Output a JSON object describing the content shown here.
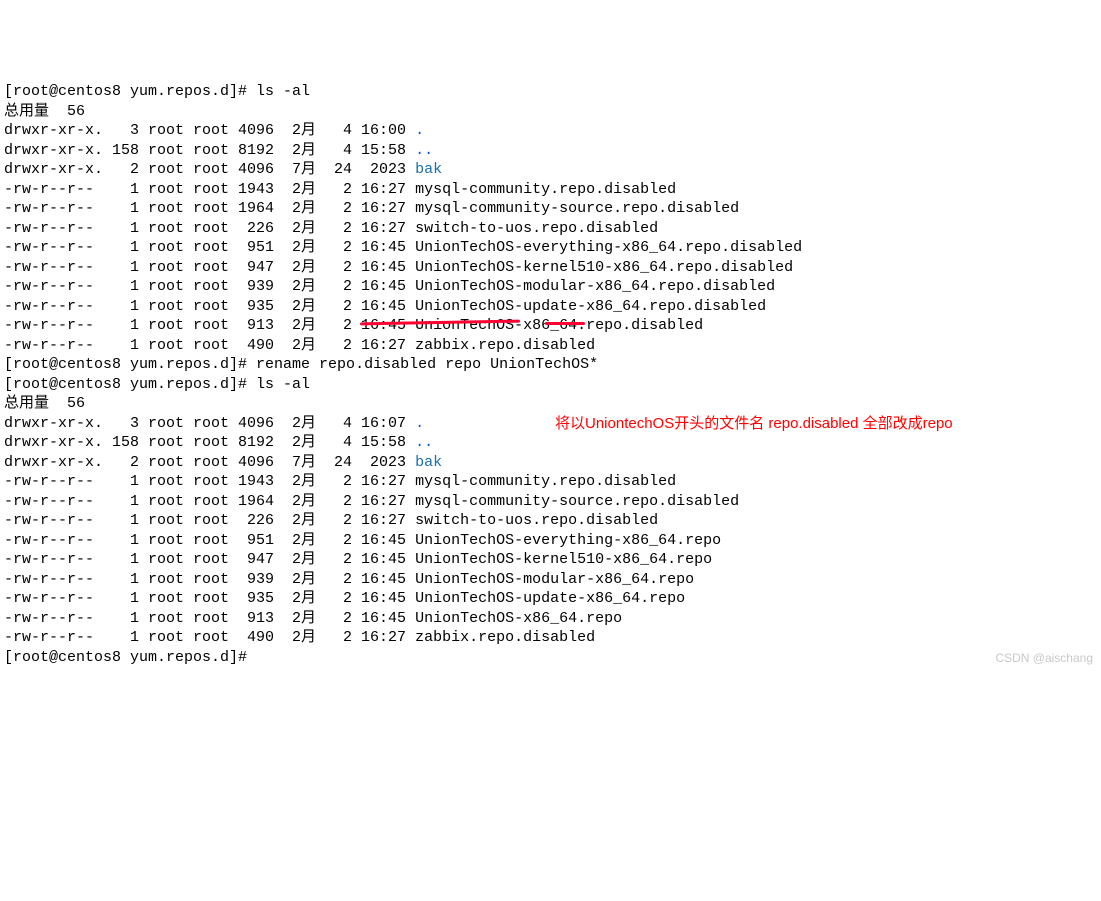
{
  "prompts": {
    "p1": "[root@centos8 yum.repos.d]# ",
    "cmd_ls": "ls -al",
    "cmd_rename": "rename repo.disabled repo UnionTechOS*",
    "total": "总用量  56"
  },
  "ls1": [
    {
      "perm": "drwxr-xr-x.",
      "links": "  3",
      "owner": "root",
      "group": "root",
      "size": "4096",
      "month": " 2月",
      "day": "  4",
      "time": "16:00",
      "name": ".",
      "cls": "dir-dot"
    },
    {
      "perm": "drwxr-xr-x.",
      "links": "158",
      "owner": "root",
      "group": "root",
      "size": "8192",
      "month": " 2月",
      "day": "  4",
      "time": "15:58",
      "name": "..",
      "cls": "dir-dot"
    },
    {
      "perm": "drwxr-xr-x.",
      "links": "  2",
      "owner": "root",
      "group": "root",
      "size": "4096",
      "month": " 7月",
      "day": " 24",
      "time": " 2023",
      "name": "bak",
      "cls": "dir-name"
    },
    {
      "perm": "-rw-r--r--",
      "links": "   1",
      "owner": "root",
      "group": "root",
      "size": "1943",
      "month": " 2月",
      "day": "  2",
      "time": "16:27",
      "name": "mysql-community.repo.disabled",
      "cls": "file"
    },
    {
      "perm": "-rw-r--r--",
      "links": "   1",
      "owner": "root",
      "group": "root",
      "size": "1964",
      "month": " 2月",
      "day": "  2",
      "time": "16:27",
      "name": "mysql-community-source.repo.disabled",
      "cls": "file"
    },
    {
      "perm": "-rw-r--r--",
      "links": "   1",
      "owner": "root",
      "group": "root",
      "size": " 226",
      "month": " 2月",
      "day": "  2",
      "time": "16:27",
      "name": "switch-to-uos.repo.disabled",
      "cls": "file"
    },
    {
      "perm": "-rw-r--r--",
      "links": "   1",
      "owner": "root",
      "group": "root",
      "size": " 951",
      "month": " 2月",
      "day": "  2",
      "time": "16:45",
      "name": "UnionTechOS-everything-x86_64.repo.disabled",
      "cls": "file"
    },
    {
      "perm": "-rw-r--r--",
      "links": "   1",
      "owner": "root",
      "group": "root",
      "size": " 947",
      "month": " 2月",
      "day": "  2",
      "time": "16:45",
      "name": "UnionTechOS-kernel510-x86_64.repo.disabled",
      "cls": "file"
    },
    {
      "perm": "-rw-r--r--",
      "links": "   1",
      "owner": "root",
      "group": "root",
      "size": " 939",
      "month": " 2月",
      "day": "  2",
      "time": "16:45",
      "name": "UnionTechOS-modular-x86_64.repo.disabled",
      "cls": "file"
    },
    {
      "perm": "-rw-r--r--",
      "links": "   1",
      "owner": "root",
      "group": "root",
      "size": " 935",
      "month": " 2月",
      "day": "  2",
      "time": "16:45",
      "name": "UnionTechOS-update-x86_64.repo.disabled",
      "cls": "file"
    },
    {
      "perm": "-rw-r--r--",
      "links": "   1",
      "owner": "root",
      "group": "root",
      "size": " 913",
      "month": " 2月",
      "day": "  2",
      "time": "16:45",
      "name": "UnionTechOS-x86_64.repo.disabled",
      "cls": "file"
    },
    {
      "perm": "-rw-r--r--",
      "links": "   1",
      "owner": "root",
      "group": "root",
      "size": " 490",
      "month": " 2月",
      "day": "  2",
      "time": "16:27",
      "name": "zabbix.repo.disabled",
      "cls": "file"
    }
  ],
  "ls2": [
    {
      "perm": "drwxr-xr-x.",
      "links": "  3",
      "owner": "root",
      "group": "root",
      "size": "4096",
      "month": " 2月",
      "day": "  4",
      "time": "16:07",
      "name": ".",
      "cls": "dir-dot"
    },
    {
      "perm": "drwxr-xr-x.",
      "links": "158",
      "owner": "root",
      "group": "root",
      "size": "8192",
      "month": " 2月",
      "day": "  4",
      "time": "15:58",
      "name": "..",
      "cls": "dir-dot"
    },
    {
      "perm": "drwxr-xr-x.",
      "links": "  2",
      "owner": "root",
      "group": "root",
      "size": "4096",
      "month": " 7月",
      "day": " 24",
      "time": " 2023",
      "name": "bak",
      "cls": "dir-name"
    },
    {
      "perm": "-rw-r--r--",
      "links": "   1",
      "owner": "root",
      "group": "root",
      "size": "1943",
      "month": " 2月",
      "day": "  2",
      "time": "16:27",
      "name": "mysql-community.repo.disabled",
      "cls": "file"
    },
    {
      "perm": "-rw-r--r--",
      "links": "   1",
      "owner": "root",
      "group": "root",
      "size": "1964",
      "month": " 2月",
      "day": "  2",
      "time": "16:27",
      "name": "mysql-community-source.repo.disabled",
      "cls": "file"
    },
    {
      "perm": "-rw-r--r--",
      "links": "   1",
      "owner": "root",
      "group": "root",
      "size": " 226",
      "month": " 2月",
      "day": "  2",
      "time": "16:27",
      "name": "switch-to-uos.repo.disabled",
      "cls": "file"
    },
    {
      "perm": "-rw-r--r--",
      "links": "   1",
      "owner": "root",
      "group": "root",
      "size": " 951",
      "month": " 2月",
      "day": "  2",
      "time": "16:45",
      "name": "UnionTechOS-everything-x86_64.repo",
      "cls": "file"
    },
    {
      "perm": "-rw-r--r--",
      "links": "   1",
      "owner": "root",
      "group": "root",
      "size": " 947",
      "month": " 2月",
      "day": "  2",
      "time": "16:45",
      "name": "UnionTechOS-kernel510-x86_64.repo",
      "cls": "file"
    },
    {
      "perm": "-rw-r--r--",
      "links": "   1",
      "owner": "root",
      "group": "root",
      "size": " 939",
      "month": " 2月",
      "day": "  2",
      "time": "16:45",
      "name": "UnionTechOS-modular-x86_64.repo",
      "cls": "file"
    },
    {
      "perm": "-rw-r--r--",
      "links": "   1",
      "owner": "root",
      "group": "root",
      "size": " 935",
      "month": " 2月",
      "day": "  2",
      "time": "16:45",
      "name": "UnionTechOS-update-x86_64.repo",
      "cls": "file"
    },
    {
      "perm": "-rw-r--r--",
      "links": "   1",
      "owner": "root",
      "group": "root",
      "size": " 913",
      "month": " 2月",
      "day": "  2",
      "time": "16:45",
      "name": "UnionTechOS-x86_64.repo",
      "cls": "file"
    },
    {
      "perm": "-rw-r--r--",
      "links": "   1",
      "owner": "root",
      "group": "root",
      "size": " 490",
      "month": " 2月",
      "day": "  2",
      "time": "16:27",
      "name": "zabbix.repo.disabled",
      "cls": "file"
    }
  ],
  "annotation": {
    "text": "将以UniontechOS开头的文件名  repo.disabled 全部改成repo"
  },
  "watermark": "CSDN @aischang"
}
